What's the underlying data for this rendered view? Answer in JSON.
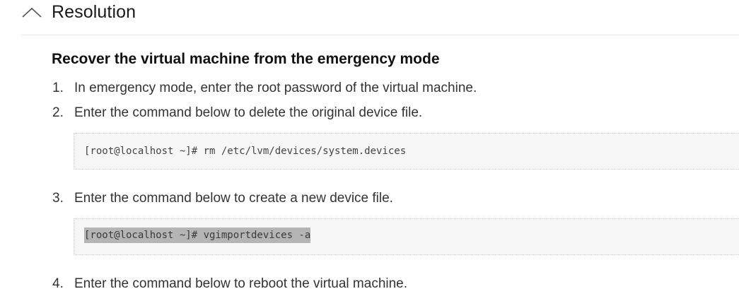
{
  "section": {
    "title": "Resolution"
  },
  "content": {
    "heading": "Recover the virtual machine from the emergency mode",
    "steps": [
      {
        "number": "1.",
        "text": "In emergency mode, enter the root password of the virtual machine."
      },
      {
        "number": "2.",
        "text": "Enter the command below to delete the original device file."
      },
      {
        "number": "3.",
        "text": "Enter the command below to create a new device file."
      },
      {
        "number": "4.",
        "text": "Enter the command below to reboot the virtual machine."
      }
    ],
    "code_blocks": [
      {
        "code": "[root@localhost ~]# rm /etc/lvm/devices/system.devices"
      },
      {
        "code": "[root@localhost ~]# vgimportdevices -a"
      }
    ]
  },
  "icons": {
    "collapse": "chevron-up-icon"
  },
  "colors": {
    "code_background": "#f7f7f7",
    "selection": "#b5b5b5",
    "divider": "#e6e6e6"
  }
}
